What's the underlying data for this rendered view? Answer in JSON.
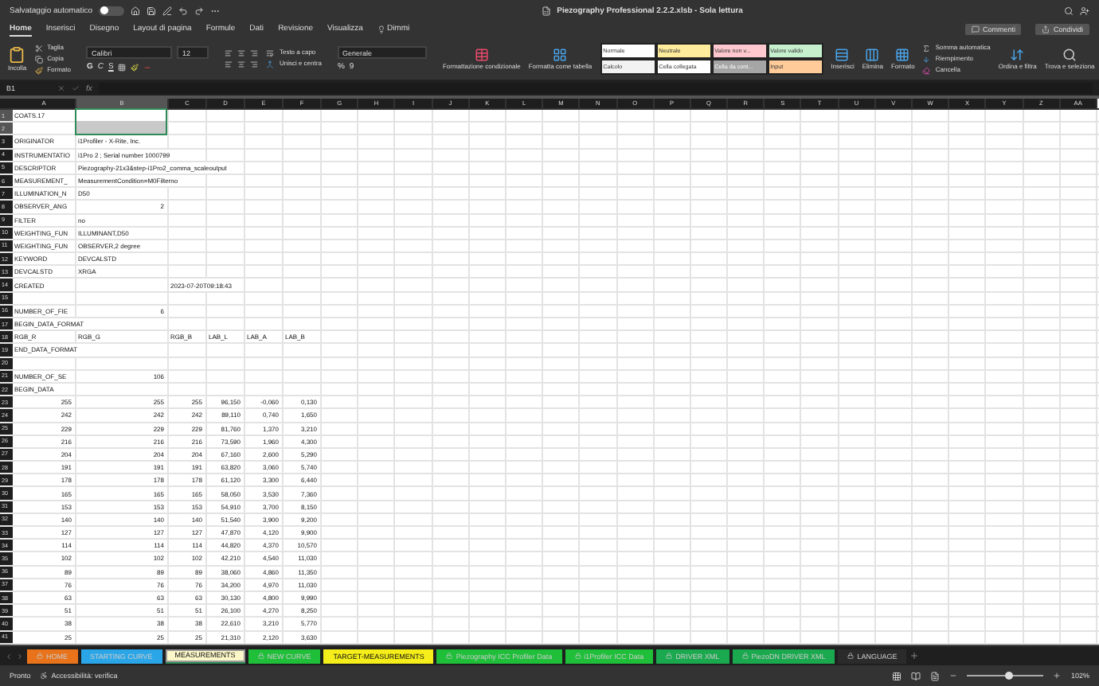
{
  "title_bar": {
    "autosave": "Salvataggio automatico",
    "autosave_on": false,
    "file_title": "Piezography Professional 2.2.2.xlsb  -  Sola lettura"
  },
  "menu_tabs": [
    {
      "label": "Home",
      "selected": true
    },
    {
      "label": "Inserisci",
      "selected": false
    },
    {
      "label": "Disegno",
      "selected": false
    },
    {
      "label": "Layout di pagina",
      "selected": false
    },
    {
      "label": "Formule",
      "selected": false
    },
    {
      "label": "Dati",
      "selected": false
    },
    {
      "label": "Revisione",
      "selected": false
    },
    {
      "label": "Visualizza",
      "selected": false
    },
    {
      "label": "Dimmi",
      "selected": false
    }
  ],
  "share_buttons": {
    "comments": "Commenti",
    "share": "Condividi"
  },
  "ribbon": {
    "paste": "Incolla",
    "cut": "Taglia",
    "copy": "Copia",
    "format_painter": "Formato",
    "font_name": "Calibri",
    "font_size": "12",
    "bold": "G",
    "italic": "C",
    "underline": "S",
    "wrap_text": "Testo a capo",
    "merge_center": "Unisci e centra",
    "number_format": "Generale",
    "percent": "%",
    "thousands": "9",
    "conditional_format": "Formattazione condizionale",
    "format_table": "Formatta come tabella",
    "styles": [
      {
        "label": "Normale",
        "color": "#ffffff"
      },
      {
        "label": "Neutrale",
        "color": "#ffeb9c"
      },
      {
        "label": "Valore non v...",
        "color": "#ffc7ce"
      },
      {
        "label": "Valore valido",
        "color": "#c6efce"
      },
      {
        "label": "Calcolo",
        "color": "#f2f2f2"
      },
      {
        "label": "Cella collegata",
        "color": "#ffffff"
      },
      {
        "label": "Cella da cont...",
        "color": "#a5a5a5"
      },
      {
        "label": "Input",
        "color": "#ffcc99"
      }
    ],
    "insert": "Inserisci",
    "delete": "Elimina",
    "format": "Formato",
    "autosum": "Somma automatica",
    "fill": "Riempimento",
    "clear": "Cancella",
    "sort_filter": "Ordina e filtra",
    "find_select": "Trova e seleziona"
  },
  "formula_bar": {
    "name_box": "B1",
    "fx": "fx"
  },
  "columns": [
    {
      "label": "A",
      "selected": false
    },
    {
      "label": "B",
      "selected": true
    },
    {
      "label": "C",
      "selected": false
    },
    {
      "label": "D",
      "selected": false
    },
    {
      "label": "E",
      "selected": false
    },
    {
      "label": "F",
      "selected": false
    },
    {
      "label": "G",
      "selected": false
    },
    {
      "label": "H",
      "selected": false
    },
    {
      "label": "I",
      "selected": false
    },
    {
      "label": "J",
      "selected": false
    },
    {
      "label": "K",
      "selected": false
    },
    {
      "label": "L",
      "selected": false
    },
    {
      "label": "M",
      "selected": false
    },
    {
      "label": "N",
      "selected": false
    },
    {
      "label": "O",
      "selected": false
    },
    {
      "label": "P",
      "selected": false
    },
    {
      "label": "Q",
      "selected": false
    },
    {
      "label": "R",
      "selected": false
    },
    {
      "label": "S",
      "selected": false
    },
    {
      "label": "T",
      "selected": false
    },
    {
      "label": "U",
      "selected": false
    },
    {
      "label": "V",
      "selected": false
    },
    {
      "label": "W",
      "selected": false
    },
    {
      "label": "X",
      "selected": false
    },
    {
      "label": "Y",
      "selected": false
    },
    {
      "label": "Z",
      "selected": false
    },
    {
      "label": "AA",
      "selected": false
    }
  ],
  "rows": [
    {
      "number": "1",
      "selected": true,
      "cells": {
        "A": "COATS.17"
      }
    },
    {
      "number": "2",
      "selected": true,
      "cells": {}
    },
    {
      "number": "3",
      "selected": false,
      "cells": {
        "A": "ORIGINATOR",
        "B": "i1Profiler - X-Rite, Inc."
      }
    },
    {
      "number": "4",
      "selected": false,
      "cells": {
        "A": "INSTRUMENTATIO",
        "B": "i1Pro 2 ; Serial number 1000799"
      }
    },
    {
      "number": "5",
      "selected": false,
      "cells": {
        "A": "DESCRIPTOR",
        "B": "Piezography-21x3&step-i1Pro2_comma_scaleoutput"
      }
    },
    {
      "number": "6",
      "selected": false,
      "cells": {
        "A": "MEASUREMENT_",
        "B": "MeasurementCondition=M0Filterno"
      }
    },
    {
      "number": "7",
      "selected": false,
      "cells": {
        "A": "ILLUMINATION_N",
        "B": "D50"
      }
    },
    {
      "number": "8",
      "selected": false,
      "cells": {
        "A": "OBSERVER_ANG",
        "B": "2"
      }
    },
    {
      "number": "9",
      "selected": false,
      "cells": {
        "A": "FILTER",
        "B": "no"
      }
    },
    {
      "number": "10",
      "selected": false,
      "cells": {
        "A": "WEIGHTING_FUN",
        "B": "ILLUMINANT,D50"
      }
    },
    {
      "number": "11",
      "selected": false,
      "cells": {
        "A": "WEIGHTING_FUN",
        "B": "OBSERVER,2 degree"
      }
    },
    {
      "number": "12",
      "selected": false,
      "cells": {
        "A": "KEYWORD",
        "B": "DEVCALSTD"
      }
    },
    {
      "number": "13",
      "selected": false,
      "cells": {
        "A": "DEVCALSTD",
        "B": "XRGA"
      }
    },
    {
      "number": "14",
      "selected": false,
      "cells": {
        "A": "CREATED",
        "C": "2023-07-20T09:18:43"
      }
    },
    {
      "number": "15",
      "selected": false,
      "cells": {}
    },
    {
      "number": "16",
      "selected": false,
      "cells": {
        "A": "NUMBER_OF_FIE",
        "B": "6"
      }
    },
    {
      "number": "17",
      "selected": false,
      "cells": {
        "A": "BEGIN_DATA_FORMAT"
      }
    },
    {
      "number": "18",
      "selected": false,
      "cells": {
        "A": "RGB_R",
        "B": "RGB_G",
        "C": "RGB_B",
        "D": "LAB_L",
        "E": "LAB_A",
        "F": "LAB_B"
      }
    },
    {
      "number": "19",
      "selected": false,
      "cells": {
        "A": "END_DATA_FORMAT"
      }
    },
    {
      "number": "20",
      "selected": false,
      "cells": {}
    },
    {
      "number": "21",
      "selected": false,
      "cells": {
        "A": "NUMBER_OF_SE",
        "B": "106"
      }
    },
    {
      "number": "22",
      "selected": false,
      "cells": {
        "A": "BEGIN_DATA"
      }
    },
    {
      "number": "23",
      "selected": false,
      "cells": {
        "A": "255",
        "B": "255",
        "C": "255",
        "D": "96,150",
        "E": "-0,060",
        "F": "0,130"
      }
    },
    {
      "number": "24",
      "selected": false,
      "cells": {
        "A": "242",
        "B": "242",
        "C": "242",
        "D": "89,110",
        "E": "0,740",
        "F": "1,650"
      }
    },
    {
      "number": "25",
      "selected": false,
      "cells": {
        "A": "229",
        "B": "229",
        "C": "229",
        "D": "81,760",
        "E": "1,370",
        "F": "3,210"
      }
    },
    {
      "number": "26",
      "selected": false,
      "cells": {
        "A": "216",
        "B": "216",
        "C": "216",
        "D": "73,590",
        "E": "1,960",
        "F": "4,300"
      }
    },
    {
      "number": "27",
      "selected": false,
      "cells": {
        "A": "204",
        "B": "204",
        "C": "204",
        "D": "67,160",
        "E": "2,600",
        "F": "5,290"
      }
    },
    {
      "number": "28",
      "selected": false,
      "cells": {
        "A": "191",
        "B": "191",
        "C": "191",
        "D": "63,820",
        "E": "3,060",
        "F": "5,740"
      }
    },
    {
      "number": "29",
      "selected": false,
      "cells": {
        "A": "178",
        "B": "178",
        "C": "178",
        "D": "61,120",
        "E": "3,300",
        "F": "6,440"
      }
    },
    {
      "number": "30",
      "selected": false,
      "cells": {
        "A": "165",
        "B": "165",
        "C": "165",
        "D": "58,050",
        "E": "3,530",
        "F": "7,360"
      }
    },
    {
      "number": "31",
      "selected": false,
      "cells": {
        "A": "153",
        "B": "153",
        "C": "153",
        "D": "54,910",
        "E": "3,700",
        "F": "8,150"
      }
    },
    {
      "number": "32",
      "selected": false,
      "cells": {
        "A": "140",
        "B": "140",
        "C": "140",
        "D": "51,540",
        "E": "3,900",
        "F": "9,200"
      }
    },
    {
      "number": "33",
      "selected": false,
      "cells": {
        "A": "127",
        "B": "127",
        "C": "127",
        "D": "47,870",
        "E": "4,120",
        "F": "9,900"
      }
    },
    {
      "number": "34",
      "selected": false,
      "cells": {
        "A": "114",
        "B": "114",
        "C": "114",
        "D": "44,820",
        "E": "4,370",
        "F": "10,570"
      }
    },
    {
      "number": "35",
      "selected": false,
      "cells": {
        "A": "102",
        "B": "102",
        "C": "102",
        "D": "42,210",
        "E": "4,540",
        "F": "11,030"
      }
    },
    {
      "number": "36",
      "selected": false,
      "cells": {
        "A": "89",
        "B": "89",
        "C": "89",
        "D": "38,060",
        "E": "4,860",
        "F": "11,350"
      }
    },
    {
      "number": "37",
      "selected": false,
      "cells": {
        "A": "76",
        "B": "76",
        "C": "76",
        "D": "34,200",
        "E": "4,970",
        "F": "11,030"
      }
    },
    {
      "number": "38",
      "selected": false,
      "cells": {
        "A": "63",
        "B": "63",
        "C": "63",
        "D": "30,130",
        "E": "4,800",
        "F": "9,990"
      }
    },
    {
      "number": "39",
      "selected": false,
      "cells": {
        "A": "51",
        "B": "51",
        "C": "51",
        "D": "26,100",
        "E": "4,270",
        "F": "8,250"
      }
    },
    {
      "number": "40",
      "selected": false,
      "cells": {
        "A": "38",
        "B": "38",
        "C": "38",
        "D": "22,610",
        "E": "3,210",
        "F": "5,770"
      }
    },
    {
      "number": "41",
      "selected": false,
      "cells": {
        "A": "25",
        "B": "25",
        "C": "25",
        "D": "21,310",
        "E": "2,120",
        "F": "3,630"
      }
    }
  ],
  "sheet_tabs": [
    {
      "label": "HOME",
      "color": "#e8731a",
      "locked": true,
      "selected": false
    },
    {
      "label": "STARTING CURVE",
      "color": "#2aa6e8",
      "locked": false,
      "selected": false
    },
    {
      "label": "MEASUREMENTS",
      "color": "#fbf7c8",
      "locked": false,
      "selected": true
    },
    {
      "label": "NEW CURVE",
      "color": "#1fbf3a",
      "locked": true,
      "selected": false
    },
    {
      "label": "TARGET-MEASUREMENTS",
      "color": "#f5ee1a",
      "locked": false,
      "selected": false
    },
    {
      "label": "Piezography ICC Profiler Data",
      "color": "#1fbf3a",
      "locked": true,
      "selected": false
    },
    {
      "label": "i1Profiler ICC Data",
      "color": "#1fbf3a",
      "locked": true,
      "selected": false
    },
    {
      "label": "DRIVER XML",
      "color": "#1aa94e",
      "locked": true,
      "selected": false
    },
    {
      "label": "PiezoDN DRIVER XML",
      "color": "#1aa94e",
      "locked": true,
      "selected": false
    },
    {
      "label": "LANGUAGE",
      "color": "#2b2b2b",
      "locked": true,
      "selected": false
    }
  ],
  "status_bar": {
    "ready": "Pronto",
    "accessibility": "Accessibilità: verifica",
    "zoom": "102%",
    "zoom_slider": {
      "level": 0.55
    }
  }
}
